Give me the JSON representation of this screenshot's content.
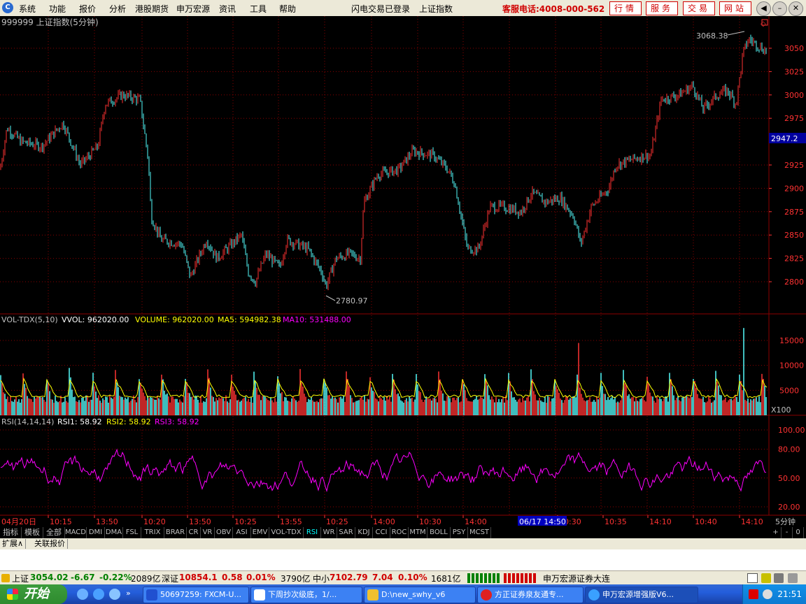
{
  "menubar": {
    "logo": "C",
    "items": [
      "系统",
      "功能",
      "报价",
      "分析",
      "港股期货",
      "申万宏源",
      "资讯",
      "工具",
      "帮助"
    ],
    "status": "闪电交易已登录",
    "index_name": "上证指数",
    "hotline": "客服电话:4008-000-562",
    "service_buttons": [
      "行情",
      "服务",
      "交易",
      "网站"
    ]
  },
  "chart": {
    "title": "999999 上证指数(5分钟)",
    "high_label": "3068.38",
    "low_label": "2780.97",
    "current_price": "2947.2",
    "price_ticks": [
      "3050",
      "3025",
      "3000",
      "2975",
      "2925",
      "2900",
      "2875",
      "2850",
      "2825",
      "2800"
    ],
    "vol_title": "VOL-TDX(5,10)",
    "vol_vvol": "VVOL: 962020.00",
    "vol_volume": "VOLUME: 962020.00",
    "vol_ma5": "MA5: 594982.38",
    "vol_ma10": "MA10: 531488.00",
    "vol_ticks": [
      "15000",
      "10000",
      "5000"
    ],
    "vol_unit": "X100",
    "rsi_title": "RSI(14,14,14)",
    "rsi1": "RSI1: 58.92",
    "rsi2": "RSI2: 58.92",
    "rsi3": "RSI3: 58.92",
    "rsi_ticks": [
      "100.00",
      "80.00",
      "50.00",
      "20.00"
    ],
    "time_start": "04月20日",
    "time_ticks": [
      "10:15",
      "13:50",
      "10:20",
      "13:50",
      "10:25",
      "13:55",
      "10:25",
      "14:00",
      "10:30",
      "14:00",
      "10:30",
      "10:35",
      "14:10",
      "10:40",
      "14:10"
    ],
    "time_highlight": "06/17 14:50",
    "period": "5分钟",
    "colors": {
      "up": "#ff3232",
      "down": "#54fcfc",
      "ma5": "#ffff00",
      "rsi": "#ff00ff",
      "grid": "#8b0000"
    }
  },
  "tabs": {
    "category": [
      "指标",
      "模板",
      "全部"
    ],
    "indicators": [
      "MACD",
      "DMI",
      "DMA",
      "FSL",
      "TRIX",
      "BRAR",
      "CR",
      "VR",
      "OBV",
      "ASI",
      "EMV",
      "VOL-TDX",
      "RSI",
      "WR",
      "SAR",
      "KDJ",
      "CCI",
      "ROC",
      "MTM",
      "BOLL",
      "PSY",
      "MCST"
    ],
    "active": "RSI",
    "controls": [
      "+",
      "-",
      "0"
    ]
  },
  "subtabs": [
    "扩展∧",
    "关联报价"
  ],
  "statusbar": {
    "sh_label": "上证",
    "sh_value": "3054.02",
    "sh_change": "-6.67",
    "sh_pct": "-0.22%",
    "sh_amount": "2089亿",
    "sz_label": "深证",
    "sz_value": "10854.1",
    "sz_change": "0.58",
    "sz_pct": "0.01%",
    "sz_amount": "3790亿",
    "zx_label": "中小",
    "zx_value": "7102.79",
    "zx_change": "7.04",
    "zx_pct": "0.10%",
    "zx_amount": "1681亿",
    "broker": "申万宏源证券大连"
  },
  "taskbar": {
    "start": "开始",
    "tasks": [
      "50697259: FXCM-U...",
      "下周抄次级底，1/...",
      "D:\\new_swhy_v6",
      "方正证券泉友通专...",
      "申万宏源增强版V6..."
    ],
    "clock": "21:51"
  }
}
